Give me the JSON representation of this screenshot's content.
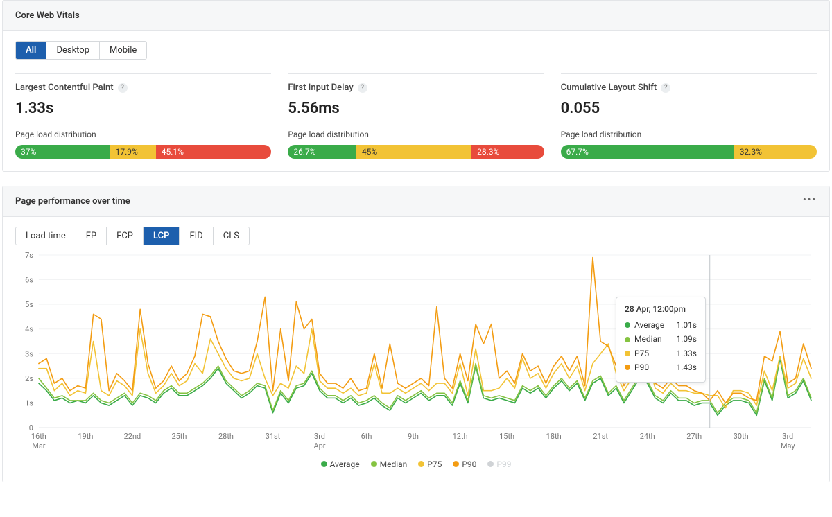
{
  "panel1": {
    "title": "Core Web Vitals",
    "tabs": [
      "All",
      "Desktop",
      "Mobile"
    ],
    "activeTab": 0,
    "metrics": [
      {
        "title": "Largest Contentful Paint",
        "value": "1.33s",
        "distLabel": "Page load distribution",
        "dist": {
          "good": "37%",
          "impr": "17.9%",
          "poor": "45.1%"
        }
      },
      {
        "title": "First Input Delay",
        "value": "5.56ms",
        "distLabel": "Page load distribution",
        "dist": {
          "good": "26.7%",
          "impr": "45%",
          "poor": "28.3%"
        }
      },
      {
        "title": "Cumulative Layout Shift",
        "value": "0.055",
        "distLabel": "Page load distribution",
        "dist": {
          "good": "67.7%",
          "impr": "32.3%",
          "poor": ""
        }
      }
    ]
  },
  "panel2": {
    "title": "Page performance over time",
    "tabs": [
      "Load time",
      "FP",
      "FCP",
      "LCP",
      "FID",
      "CLS"
    ],
    "activeTab": 3,
    "legend": [
      {
        "name": "Average",
        "color": "#3aab49"
      },
      {
        "name": "Median",
        "color": "#85c341"
      },
      {
        "name": "P75",
        "color": "#f2c335"
      },
      {
        "name": "P90",
        "color": "#f39c12"
      },
      {
        "name": "P99",
        "color": "#d0d3d6",
        "disabled": true
      }
    ],
    "tooltip": {
      "title": "28 Apr, 12:00pm",
      "rows": [
        {
          "label": "Average",
          "value": "1.01s",
          "color": "#3aab49"
        },
        {
          "label": "Median",
          "value": "1.09s",
          "color": "#85c341"
        },
        {
          "label": "P75",
          "value": "1.33s",
          "color": "#f2c335"
        },
        {
          "label": "P90",
          "value": "1.43s",
          "color": "#f39c12"
        }
      ]
    },
    "yLabels": [
      "7s",
      "6s",
      "5s",
      "4s",
      "3s",
      "2s",
      "1s",
      "0"
    ]
  },
  "chart_data": {
    "type": "line",
    "title": "Page performance over time — LCP",
    "ylabel": "seconds",
    "ylim": [
      0,
      7
    ],
    "x_step_hours": 12,
    "x_tick_labels": [
      "16th Mar",
      "19th",
      "22nd",
      "25th",
      "28th",
      "31st",
      "3rd Apr",
      "6th",
      "9th",
      "12th",
      "15th",
      "18th",
      "21st",
      "24th",
      "27th",
      "30th",
      "3rd May"
    ],
    "series": [
      {
        "name": "Average",
        "color": "#3aab49",
        "values": [
          1.8,
          1.5,
          1.1,
          1.2,
          1.0,
          1.1,
          1.0,
          1.3,
          1.0,
          0.9,
          1.1,
          1.3,
          0.9,
          1.3,
          1.2,
          1.0,
          1.4,
          1.6,
          1.3,
          1.3,
          1.5,
          1.7,
          2.0,
          2.4,
          1.8,
          1.5,
          1.2,
          1.4,
          1.7,
          1.6,
          0.6,
          1.4,
          1.0,
          1.6,
          1.7,
          2.2,
          1.5,
          1.2,
          1.2,
          1.0,
          1.2,
          0.9,
          1.0,
          1.2,
          0.9,
          0.7,
          1.2,
          1.0,
          1.2,
          1.4,
          1.1,
          1.3,
          1.3,
          0.9,
          1.8,
          1.0,
          2.5,
          1.2,
          1.1,
          1.2,
          1.1,
          1.0,
          1.6,
          1.4,
          1.6,
          1.2,
          1.6,
          1.9,
          1.5,
          1.8,
          1.1,
          1.8,
          2.0,
          1.3,
          1.6,
          1.0,
          1.5,
          2.0,
          1.8,
          1.2,
          1.0,
          1.4,
          1.1,
          1.1,
          0.9,
          1.0,
          1.0,
          0.5,
          0.9,
          1.1,
          1.1,
          1.0,
          0.5,
          1.9,
          1.1,
          2.8,
          1.2,
          1.4,
          1.9,
          1.1
        ]
      },
      {
        "name": "Median",
        "color": "#85c341",
        "values": [
          2.0,
          1.6,
          1.2,
          1.3,
          1.1,
          1.1,
          1.1,
          1.4,
          1.1,
          1.0,
          1.2,
          1.4,
          1.0,
          1.4,
          1.3,
          1.1,
          1.5,
          1.7,
          1.4,
          1.4,
          1.6,
          1.8,
          2.1,
          2.5,
          1.9,
          1.6,
          1.3,
          1.5,
          1.8,
          1.7,
          0.7,
          1.5,
          1.1,
          1.7,
          1.8,
          2.3,
          1.6,
          1.3,
          1.3,
          1.1,
          1.3,
          1.0,
          1.1,
          1.3,
          1.0,
          0.8,
          1.3,
          1.1,
          1.3,
          1.5,
          1.2,
          1.4,
          1.4,
          1.0,
          1.9,
          1.1,
          2.6,
          1.3,
          1.2,
          1.3,
          1.2,
          1.1,
          1.7,
          1.5,
          1.7,
          1.3,
          1.7,
          2.0,
          1.6,
          1.9,
          1.2,
          1.9,
          2.1,
          1.4,
          1.7,
          1.1,
          1.6,
          2.1,
          1.9,
          1.3,
          1.1,
          1.5,
          1.2,
          1.2,
          1.0,
          1.1,
          1.1,
          0.6,
          1.0,
          1.2,
          1.2,
          1.1,
          0.6,
          2.0,
          1.2,
          2.9,
          1.3,
          1.5,
          2.0,
          1.2
        ]
      },
      {
        "name": "P75",
        "color": "#f2c335",
        "values": [
          2.4,
          2.4,
          1.5,
          1.8,
          1.3,
          1.5,
          1.4,
          3.5,
          1.5,
          1.3,
          1.9,
          1.7,
          1.3,
          4.0,
          2.2,
          1.4,
          1.7,
          2.2,
          1.7,
          1.9,
          2.6,
          2.2,
          3.6,
          3.0,
          2.4,
          2.0,
          1.9,
          2.0,
          3.0,
          2.0,
          1.3,
          1.8,
          1.6,
          2.5,
          2.2,
          4.0,
          1.9,
          1.6,
          1.6,
          1.4,
          1.6,
          1.3,
          1.4,
          2.6,
          1.4,
          1.4,
          1.6,
          1.4,
          1.6,
          1.8,
          1.5,
          1.8,
          1.8,
          1.4,
          2.6,
          1.3,
          3.2,
          1.5,
          1.5,
          1.6,
          2.0,
          1.6,
          2.8,
          2.0,
          2.2,
          1.6,
          2.2,
          2.6,
          2.0,
          2.5,
          1.5,
          2.6,
          3.0,
          3.4,
          2.2,
          1.5,
          2.0,
          2.6,
          2.8,
          1.6,
          1.4,
          1.8,
          1.5,
          1.5,
          1.4,
          1.4,
          1.3,
          1.3,
          0.8,
          1.5,
          1.5,
          1.4,
          0.9,
          2.3,
          1.5,
          2.9,
          1.6,
          1.8,
          2.8,
          2.0
        ]
      },
      {
        "name": "P90",
        "color": "#f39c12",
        "values": [
          2.6,
          2.8,
          1.8,
          2.0,
          1.5,
          1.7,
          1.6,
          4.6,
          4.4,
          1.5,
          2.2,
          1.9,
          1.5,
          4.8,
          2.6,
          1.6,
          1.9,
          2.5,
          1.9,
          2.2,
          2.9,
          4.6,
          4.5,
          3.5,
          2.8,
          2.3,
          2.2,
          2.3,
          3.5,
          5.3,
          1.5,
          4.0,
          1.9,
          5.1,
          4.0,
          4.4,
          2.2,
          1.8,
          1.8,
          1.6,
          2.0,
          1.5,
          1.6,
          3.0,
          1.6,
          3.4,
          1.8,
          1.6,
          1.8,
          2.0,
          1.7,
          4.9,
          2.0,
          1.6,
          3.0,
          1.9,
          4.2,
          3.4,
          4.2,
          2.0,
          2.3,
          1.8,
          3.0,
          2.3,
          2.5,
          1.8,
          2.5,
          2.9,
          2.3,
          2.9,
          1.7,
          6.9,
          3.5,
          3.3,
          2.5,
          1.7,
          2.3,
          2.9,
          3.1,
          1.8,
          1.6,
          2.0,
          1.7,
          1.7,
          1.5,
          1.4,
          1.1,
          1.5,
          1.0,
          1.4,
          1.4,
          1.2,
          1.1,
          2.9,
          2.7,
          3.9,
          1.8,
          2.0,
          3.4,
          2.4
        ]
      }
    ],
    "tooltip_point_index": 86
  }
}
